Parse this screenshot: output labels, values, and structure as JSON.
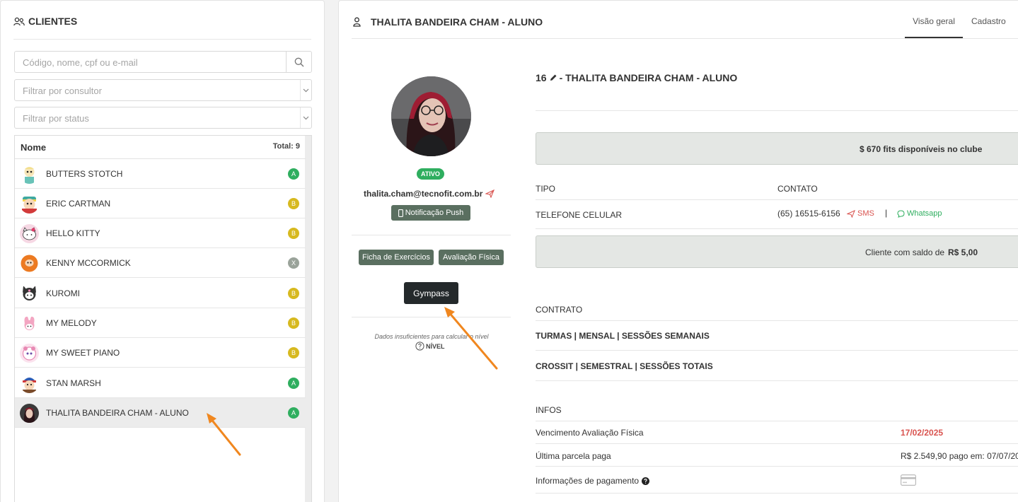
{
  "clients": {
    "title": "CLIENTES",
    "search_placeholder": "Código, nome, cpf ou e-mail",
    "filter_consultant": "Filtrar por consultor",
    "filter_status": "Filtrar por status",
    "col_name": "Nome",
    "total": "Total: 9",
    "rows": [
      {
        "name": "BUTTERS STOTCH",
        "badge": "A"
      },
      {
        "name": "ERIC CARTMAN",
        "badge": "B"
      },
      {
        "name": "HELLO KITTY",
        "badge": "B"
      },
      {
        "name": "KENNY MCCORMICK",
        "badge": "X"
      },
      {
        "name": "KUROMI",
        "badge": "B"
      },
      {
        "name": "MY MELODY",
        "badge": "B"
      },
      {
        "name": "MY SWEET PIANO",
        "badge": "B"
      },
      {
        "name": "STAN MARSH",
        "badge": "A"
      },
      {
        "name": "THALITA BANDEIRA CHAM - ALUNO",
        "badge": "A"
      }
    ]
  },
  "profile": {
    "header_title": "THALITA BANDEIRA CHAM - ALUNO",
    "tabs": [
      "Visão geral",
      "Cadastro"
    ],
    "status": "ATIVO",
    "email": "thalita.cham@tecnofit.com.br",
    "push_button": "Notificação Push",
    "exercise_button": "Ficha de Exercícios",
    "assessment_button": "Avaliação Física",
    "gympass_button": "Gympass",
    "level_note": "Dados insuficientes para calcular o nível",
    "level_label": "NÍVEL"
  },
  "details": {
    "id": "16",
    "name": "- THALITA BANDEIRA CHAM - ALUNO",
    "fits": "$ 670 fits disponíveis no clube",
    "type_header": "TIPO",
    "contact_header": "CONTATO",
    "phone_type": "TELEFONE CELULAR",
    "phone": "(65) 16515-6156",
    "sms": "SMS",
    "separator": "|",
    "whatsapp": "Whatsapp",
    "balance_prefix": "Cliente com saldo de",
    "balance_value": "R$ 5,00",
    "contract_header": "CONTRATO",
    "contract1": "TURMAS | MENSAL | SESSÕES SEMANAIS",
    "contract2": "CROSSIT | SEMESTRAL | SESSÕES TOTAIS",
    "infos_header": "INFOS",
    "exam_label": "Vencimento Avaliação Física",
    "exam_date": "17/02/2025",
    "last_payment_label": "Última parcela paga",
    "last_payment_value": "R$ 2.549,90 pago em: 07/07/20",
    "payment_info_label": "Informações de pagamento"
  }
}
